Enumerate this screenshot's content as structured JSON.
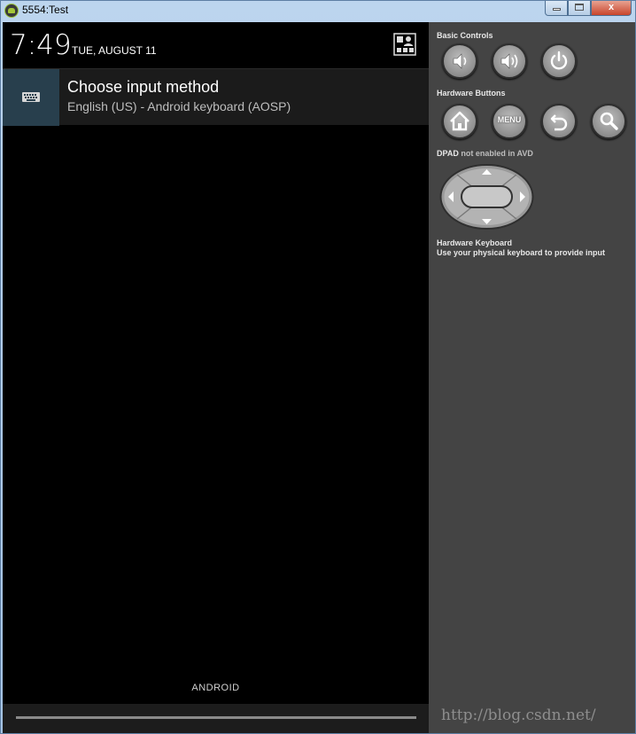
{
  "window": {
    "title": "5554:Test",
    "controls": {
      "minimize": "",
      "maximize": "",
      "close": "x"
    }
  },
  "status_bar": {
    "time": "7:49",
    "date": "TUE, AUGUST 11",
    "settings_icon": "quick-settings-icon"
  },
  "notification": {
    "icon": "keyboard-icon",
    "title": "Choose input method",
    "subtitle": "English (US) - Android keyboard (AOSP)"
  },
  "device": {
    "footer_label": "ANDROID"
  },
  "controls_panel": {
    "basic_controls_label": "Basic Controls",
    "basic_controls": [
      {
        "name": "volume-down",
        "icon": "volume-down-icon"
      },
      {
        "name": "volume-up",
        "icon": "volume-up-icon"
      },
      {
        "name": "power",
        "icon": "power-icon"
      }
    ],
    "hardware_buttons_label": "Hardware Buttons",
    "hardware_buttons": [
      {
        "name": "home",
        "icon": "home-icon"
      },
      {
        "name": "menu",
        "label": "MENU"
      },
      {
        "name": "back",
        "icon": "back-icon"
      },
      {
        "name": "search",
        "icon": "search-icon"
      }
    ],
    "dpad_label_bold": "DPAD",
    "dpad_label_rest": "not enabled in AVD",
    "hardware_keyboard_label": "Hardware Keyboard",
    "hardware_keyboard_desc": "Use your physical keyboard to provide input"
  },
  "watermark": "http://blog.csdn.net/"
}
